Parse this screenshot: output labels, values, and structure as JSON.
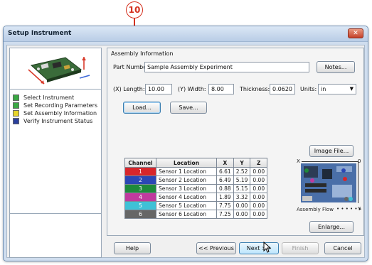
{
  "callout": {
    "number": "10"
  },
  "window": {
    "title": "Setup Instrument",
    "close_glyph": "✕"
  },
  "steps": [
    {
      "label": "Select Instrument",
      "color": "#3aa843"
    },
    {
      "label": "Set Recording Parameters",
      "color": "#3aa843"
    },
    {
      "label": "Set Assembly Information",
      "color": "#e8d52a"
    },
    {
      "label": "Verify Instrument Status",
      "color": "#2a3f9e"
    }
  ],
  "assembly": {
    "group_label": "Assembly Information",
    "part_number_label": "Part Number:",
    "part_number_value": "Sample Assembly Experiment",
    "notes_button": "Notes...",
    "length_label": "(X) Length:",
    "length_value": "10.00",
    "width_label": "(Y) Width:",
    "width_value": "8.00",
    "thickness_label": "Thickness:",
    "thickness_value": "0.0620",
    "units_label": "Units:",
    "units_value": "in",
    "load_button": "Load...",
    "save_button": "Save..."
  },
  "table": {
    "headers": [
      "Channel",
      "Location",
      "X",
      "Y",
      "Z"
    ],
    "rows": [
      {
        "channel": "1",
        "color": "#d7262b",
        "location": "Sensor 1 Location",
        "x": "6.61",
        "y": "2.52",
        "z": "0.00"
      },
      {
        "channel": "2",
        "color": "#2b47b5",
        "location": "Sensor 2 Location",
        "x": "6.49",
        "y": "5.19",
        "z": "0.00"
      },
      {
        "channel": "3",
        "color": "#1e8a3a",
        "location": "Sensor 3 Location",
        "x": "0.88",
        "y": "5.15",
        "z": "0.00"
      },
      {
        "channel": "4",
        "color": "#c03a9e",
        "location": "Sensor 4 Location",
        "x": "1.89",
        "y": "3.32",
        "z": "0.00"
      },
      {
        "channel": "5",
        "color": "#3fc1d6",
        "location": "Sensor 5 Location",
        "x": "7.75",
        "y": "0.00",
        "z": "0.00"
      },
      {
        "channel": "6",
        "color": "#666666",
        "location": "Sensor 6 Location",
        "x": "7.25",
        "z": "0.00",
        "y": "0.00"
      }
    ]
  },
  "image": {
    "image_file_button": "Image File...",
    "axis_x_label": "X",
    "axis_y_label": "Y",
    "axis_origin_label": "0",
    "assembly_flow_label": "Assembly Flow",
    "enlarge_button": "Enlarge..."
  },
  "footer": {
    "help_button": "Help",
    "previous_button": "<< Previous",
    "next_button": "Next >>",
    "finish_button": "Finish",
    "cancel_button": "Cancel"
  }
}
